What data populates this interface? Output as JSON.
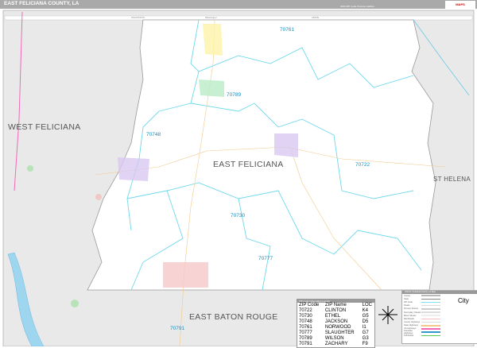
{
  "header": {
    "title": "EAST FELICIANA COUNTY, LA",
    "edition": "2020 ZIP Code Premium Edition",
    "logo": "MAPS"
  },
  "adjacent": {
    "top_left": "WILKINSON",
    "top_right": "AMITE",
    "state_line": "Mississippi"
  },
  "counties": {
    "main": "EAST FELICIANA",
    "west": "WEST FELICIANA",
    "east": "ST HELENA",
    "south": "EAST BATON ROUGE"
  },
  "zip_labels": [
    "70761",
    "70789",
    "70748",
    "70722",
    "70730",
    "70777",
    "70791"
  ],
  "zip_table": {
    "title": "ZIP Code Information Locator",
    "headers": [
      "ZIP Code",
      "ZIP Name",
      "LOC"
    ],
    "rows": [
      [
        "70722",
        "CLINTON",
        "K4"
      ],
      [
        "70730",
        "ETHEL",
        "G5"
      ],
      [
        "70748",
        "JACKSON",
        "D5"
      ],
      [
        "70761",
        "NORWOOD",
        "I1"
      ],
      [
        "70777",
        "SLAUGHTER",
        "G7"
      ],
      [
        "70789",
        "WILSON",
        "G3"
      ],
      [
        "70791",
        "ZACHARY",
        "F9"
      ]
    ]
  },
  "legend": {
    "title": "2020 E. Feliciana County, LA Map",
    "items": [
      {
        "label": "County",
        "color": "#bbbbbb"
      },
      {
        "label": "State",
        "color": "#888888"
      },
      {
        "label": "ZIP Code",
        "color": "#7fe0f0"
      },
      {
        "label": "Roads",
        "color": "#dddddd"
      },
      {
        "label": "Primary Streets",
        "color": "#cccccc"
      },
      {
        "label": "Secondary Streets",
        "color": "#dddddd"
      },
      {
        "label": "Minor Streets",
        "color": "#eeeeee"
      },
      {
        "label": "Rail Roads",
        "color": "#f4c0c0"
      },
      {
        "label": "County Highways",
        "color": "#dddddd"
      },
      {
        "label": "State Highways",
        "color": "#f2c98a"
      },
      {
        "label": "US Highways",
        "color": "#f06ab8"
      },
      {
        "label": "Interstate Highways",
        "color": "#3399cc"
      },
      {
        "label": "Toll Roads",
        "color": "#55cc55"
      }
    ],
    "city_label": "City"
  }
}
